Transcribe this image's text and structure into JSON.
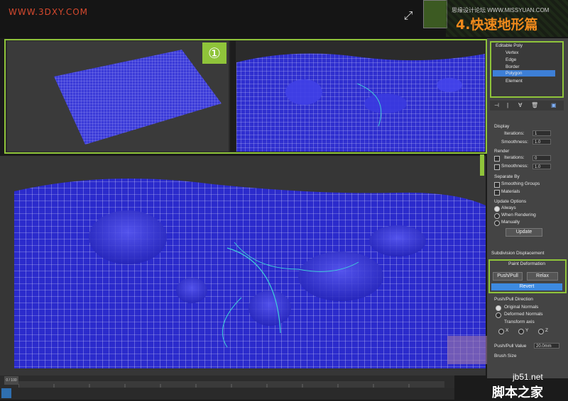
{
  "header": {
    "watermark": "WWW.3DXY.COM",
    "site_text": "思缘设计论坛  WWW.MISSYUAN.COM",
    "tutorial_title": "4.快速地形篇"
  },
  "viewport_badge": "①",
  "stack": {
    "title": "Editable Poly",
    "items": [
      "Vertex",
      "Edge",
      "Border",
      "Polygon",
      "Element"
    ],
    "selected": "Polygon"
  },
  "panel": {
    "display_label": "Display",
    "iterations_label": "Iterations:",
    "iterations_value": "1",
    "smoothness_label": "Smoothness:",
    "smoothness_value": "1.0",
    "render_label": "Render",
    "render_iterations_label": "Iterations:",
    "render_iterations_value": "0",
    "render_smoothness_label": "Smoothness:",
    "render_smoothness_value": "1.0",
    "separate_by_label": "Separate By",
    "smoothing_groups_label": "Smoothing Groups",
    "materials_label": "Materials",
    "update_options_label": "Update Options",
    "always_label": "Always",
    "when_rendering_label": "When Rendering",
    "manually_label": "Manually",
    "update_button": "Update",
    "subdivision_displacement": "Subdivision Displacement",
    "paint_deformation": "Paint Deformation",
    "push_pull_button": "Push/Pull",
    "relax_button": "Relax",
    "revert_button": "Revert",
    "push_pull_direction": "Push/Pull Direction",
    "original_normals": "Original Normals",
    "deformed_normals": "Deformed Normals",
    "transform_axis": "Transform axis",
    "axis_x": "X",
    "axis_y": "Y",
    "axis_z": "Z",
    "push_pull_value_label": "Push/Pull Value",
    "push_pull_value": "20.0mm",
    "brush_size_label": "Brush Size"
  },
  "timeline": {
    "frame_label": "0 / 100"
  },
  "footer": {
    "site_mark": "jb51.net",
    "site_cn": "脚本之家"
  },
  "colors": {
    "accent_green": "#8fc43a",
    "mesh_blue": "#2a2ad0",
    "selection_blue": "#3d7fd6",
    "title_orange": "#f08a1c"
  }
}
